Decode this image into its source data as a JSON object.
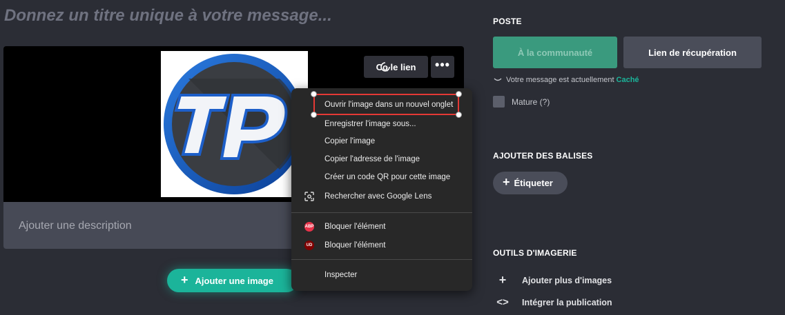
{
  "editor": {
    "title_placeholder": "Donnez un titre unique à votre message...",
    "description_placeholder": "Ajouter une description",
    "copy_link_label": "Co  le lien",
    "more_label": "•••",
    "add_image_label": "Ajouter une image",
    "image_logo_text": "TP"
  },
  "context_menu": {
    "items": [
      {
        "label": "Ouvrir l'image dans un nouvel onglet",
        "icon": ""
      },
      {
        "label": "Enregistrer l'image sous...",
        "icon": ""
      },
      {
        "label": "Copier l'image",
        "icon": ""
      },
      {
        "label": "Copier l'adresse de l'image",
        "icon": ""
      },
      {
        "label": "Créer un code QR pour cette image",
        "icon": ""
      },
      {
        "label": "Rechercher avec Google Lens",
        "icon": "google-lens-icon"
      },
      {
        "label": "Bloquer l'élément",
        "icon": "adblock-plus-icon",
        "badge": "ABP"
      },
      {
        "label": "Bloquer l'élément",
        "icon": "ublock-origin-icon",
        "badge": "UD"
      },
      {
        "label": "Inspecter",
        "icon": ""
      }
    ]
  },
  "sidebar": {
    "post_title": "POSTE",
    "community_button": "À la communauté",
    "recovery_button": "Lien de récupération",
    "status_text": "Votre message est actuellement",
    "status_value": "Caché",
    "mature_label": "Mature (?)",
    "tags_title": "AJOUTER DES BALISES",
    "tag_button": "Étiqueter",
    "tools_title": "OUTILS D'IMAGERIE",
    "tools": [
      {
        "label": "Ajouter plus d'images",
        "icon": "plus-icon"
      },
      {
        "label": "Intégrer la publication",
        "icon": "code-icon"
      }
    ]
  },
  "colors": {
    "background": "#2b2d35",
    "accent": "#1bb49a",
    "highlight": "#e53935"
  }
}
